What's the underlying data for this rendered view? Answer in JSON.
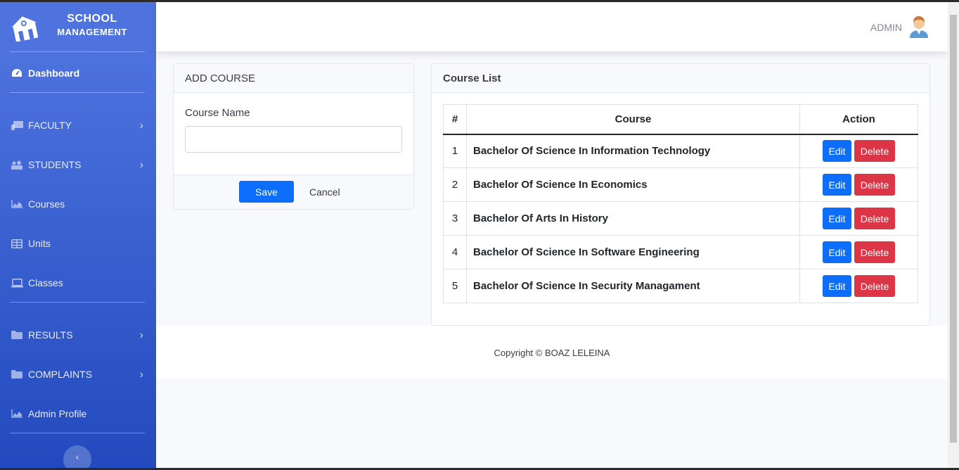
{
  "brand": {
    "line1": "SCHOOL",
    "line2": "MANAGEMENT"
  },
  "sidebar": {
    "items": [
      {
        "label": "Dashboard",
        "icon": "tachometer-icon"
      },
      {
        "label": "FACULTY",
        "icon": "chalkboard-icon"
      },
      {
        "label": "STUDENTS",
        "icon": "users-icon"
      },
      {
        "label": "Courses",
        "icon": "chart-area-icon"
      },
      {
        "label": "Units",
        "icon": "table-icon"
      },
      {
        "label": "Classes",
        "icon": "laptop-icon"
      },
      {
        "label": "RESULTS",
        "icon": "folder-icon"
      },
      {
        "label": "COMPLAINTS",
        "icon": "folder-icon"
      },
      {
        "label": "Admin Profile",
        "icon": "chart-area-icon"
      }
    ]
  },
  "topbar": {
    "user": "ADMIN"
  },
  "add_course": {
    "title": "ADD COURSE",
    "field_label": "Course Name",
    "field_value": "",
    "save": "Save",
    "cancel": "Cancel"
  },
  "course_list": {
    "title": "Course List",
    "headers": [
      "#",
      "Course",
      "Action"
    ],
    "rows": [
      {
        "num": "1",
        "course": "Bachelor Of Science In Information Technology"
      },
      {
        "num": "2",
        "course": "Bachelor Of Science In Economics"
      },
      {
        "num": "3",
        "course": "Bachelor Of Arts In History"
      },
      {
        "num": "4",
        "course": "Bachelor Of Science In Software Engineering"
      },
      {
        "num": "5",
        "course": "Bachelor Of Science In Security Managament"
      }
    ],
    "edit_label": "Edit",
    "delete_label": "Delete"
  },
  "footer": {
    "text": "Copyright © BOAZ LELEINA"
  },
  "colors": {
    "sidebar_top": "#4e73df",
    "sidebar_bottom": "#224abe",
    "primary": "#0d6efd",
    "danger": "#dc3545"
  }
}
